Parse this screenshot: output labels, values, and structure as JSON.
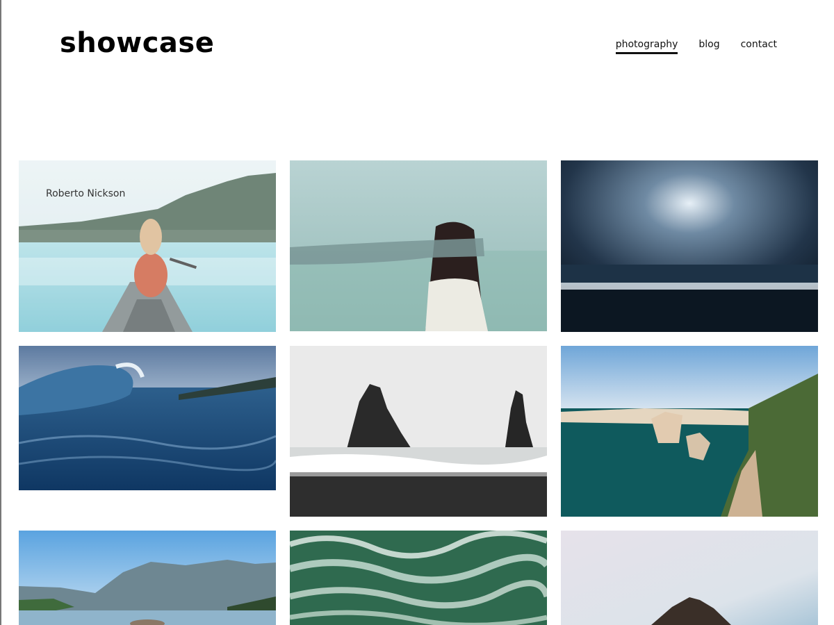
{
  "brand": {
    "name": "showcase"
  },
  "nav": {
    "items": [
      {
        "label": "photography",
        "active": true
      },
      {
        "label": "blog",
        "active": false
      },
      {
        "label": "contact",
        "active": false
      }
    ]
  },
  "gallery": {
    "tiles": [
      {
        "caption": "Roberto Nickson",
        "subject": "woman paddling canoe on mountain lake"
      },
      {
        "subject": "blindfolded woman by the sea"
      },
      {
        "subject": "stormy clouds over dark beach"
      },
      {
        "subject": "curling ocean wave"
      },
      {
        "subject": "sea stacks on black sand beach"
      },
      {
        "subject": "coastal cliffs and sea arches"
      },
      {
        "subject": "mountain lake with forested shore"
      },
      {
        "subject": "aerial view of foaming ocean water"
      },
      {
        "subject": "rock silhouette under pale sky"
      }
    ]
  }
}
